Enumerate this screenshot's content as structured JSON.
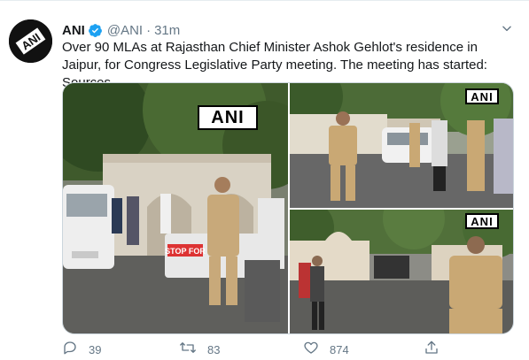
{
  "tweet": {
    "author_name": "ANI",
    "handle": "@ANI",
    "separator": "·",
    "time": "31m",
    "text": "Over 90 MLAs at Rajasthan Chief Minister Ashok Gehlot's residence in Jaipur, for Congress Legislative Party meeting. The meeting has started: Sources.",
    "avatar_logo_text": "ANI"
  },
  "media": {
    "watermark": "ANI",
    "banner_text": "STOP FOR"
  },
  "actions": {
    "reply_count": "39",
    "retweet_count": "83",
    "like_count": "874"
  },
  "icons": {
    "verified": "verified-badge-icon",
    "caret": "chevron-down-icon",
    "reply": "reply-icon",
    "retweet": "retweet-icon",
    "like": "heart-icon",
    "share": "share-icon"
  },
  "colors": {
    "verified": "#1da1f2",
    "secondary_text": "#657786",
    "primary_text": "#14171a"
  }
}
